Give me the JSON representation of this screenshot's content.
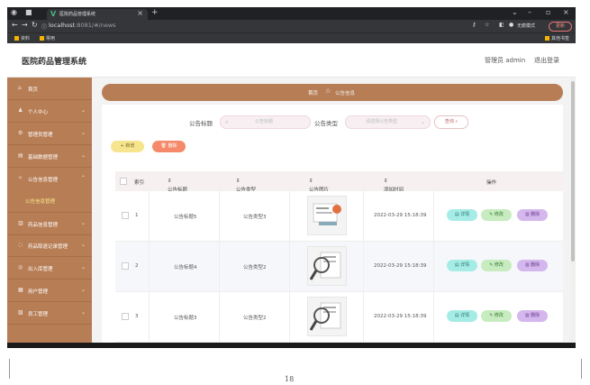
{
  "browser": {
    "tab_title": "医院药品管理系统",
    "url_host": "localhost",
    "url_rest": ":8081/#/news",
    "incognito_label": "无痕模式",
    "update_label": "更新",
    "bookmarks": [
      "资料",
      "常用"
    ],
    "other_bookmarks": "其他书签"
  },
  "header": {
    "app_title": "医院药品管理系统",
    "user": "管理员 admin",
    "logout": "退出登录"
  },
  "sidebar": {
    "items": [
      {
        "label": "首页",
        "icon": "home-icon"
      },
      {
        "label": "个人中心",
        "icon": "user-icon"
      },
      {
        "label": "管理员管理",
        "icon": "admin-icon"
      },
      {
        "label": "基础数据管理",
        "icon": "data-icon"
      },
      {
        "label": "公告信息管理",
        "icon": "notice-icon"
      },
      {
        "label": "药品信息管理",
        "icon": "drug-icon"
      },
      {
        "label": "药品取退记录管理",
        "icon": "record-icon"
      },
      {
        "label": "出入库管理",
        "icon": "stock-icon"
      },
      {
        "label": "用户管理",
        "icon": "users-icon"
      },
      {
        "label": "员工管理",
        "icon": "staff-icon"
      }
    ],
    "active_sub": "公告信息管理"
  },
  "breadcrumb": {
    "home": "首页",
    "current": "公告信息"
  },
  "search": {
    "title_label": "公告标题",
    "title_placeholder": "公告标题",
    "type_label": "公告类型",
    "type_placeholder": "请选择公告类型",
    "query_button": "查询"
  },
  "toolbar": {
    "add": "新增",
    "delete": "删除"
  },
  "table": {
    "headers": [
      "索引",
      "公告标题",
      "公告类型",
      "公告图片",
      "添加时间",
      "操作"
    ],
    "rows": [
      {
        "index": "1",
        "title": "公告标题5",
        "type": "公告类型3",
        "time": "2022-03-29 15:18:39"
      },
      {
        "index": "2",
        "title": "公告标题4",
        "type": "公告类型2",
        "time": "2022-03-29 15:18:39"
      },
      {
        "index": "3",
        "title": "公告标题3",
        "type": "公告类型2",
        "time": "2022-03-29 15:18:39"
      }
    ],
    "actions": {
      "detail": "详情",
      "edit": "修改",
      "delete": "删除"
    }
  },
  "colors": {
    "brand": "#b77d55",
    "active": "#f8e68a",
    "detail": "#a6ece6",
    "edit": "#c6ecc0",
    "del": "#d4b7ec"
  },
  "page_number": "18"
}
